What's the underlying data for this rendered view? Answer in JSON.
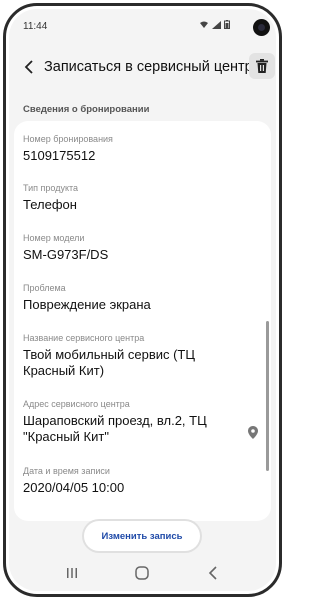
{
  "status_bar": {
    "time": "11:44"
  },
  "app_bar": {
    "title": "Записаться в сервисный центр"
  },
  "section": {
    "header": "Сведения о бронировании"
  },
  "fields": [
    {
      "label": "Номер бронирования",
      "value": "5109175512"
    },
    {
      "label": "Тип продукта",
      "value": "Телефон"
    },
    {
      "label": "Номер модели",
      "value": "SM-G973F/DS"
    },
    {
      "label": "Проблема",
      "value": "Повреждение экрана"
    },
    {
      "label": "Название сервисного центра",
      "value": "Твой мобильный сервис   (ТЦ Красный Кит)"
    },
    {
      "label": "Адрес сервисного центра",
      "value": "Шараповский проезд, вл.2, ТЦ \"Красный Кит\""
    },
    {
      "label": "Дата и время записи",
      "value": "2020/04/05 10:00"
    }
  ],
  "actions": {
    "edit_label": "Изменить запись"
  },
  "icons": {
    "back": "arrow-left-icon",
    "delete": "trash-icon",
    "location": "location-pin-icon",
    "nav_recents": "recents-icon",
    "nav_home": "home-icon",
    "nav_back": "back-icon"
  },
  "colors": {
    "accent": "#1f4aa8",
    "background": "#f4f4f4",
    "card": "#ffffff"
  }
}
